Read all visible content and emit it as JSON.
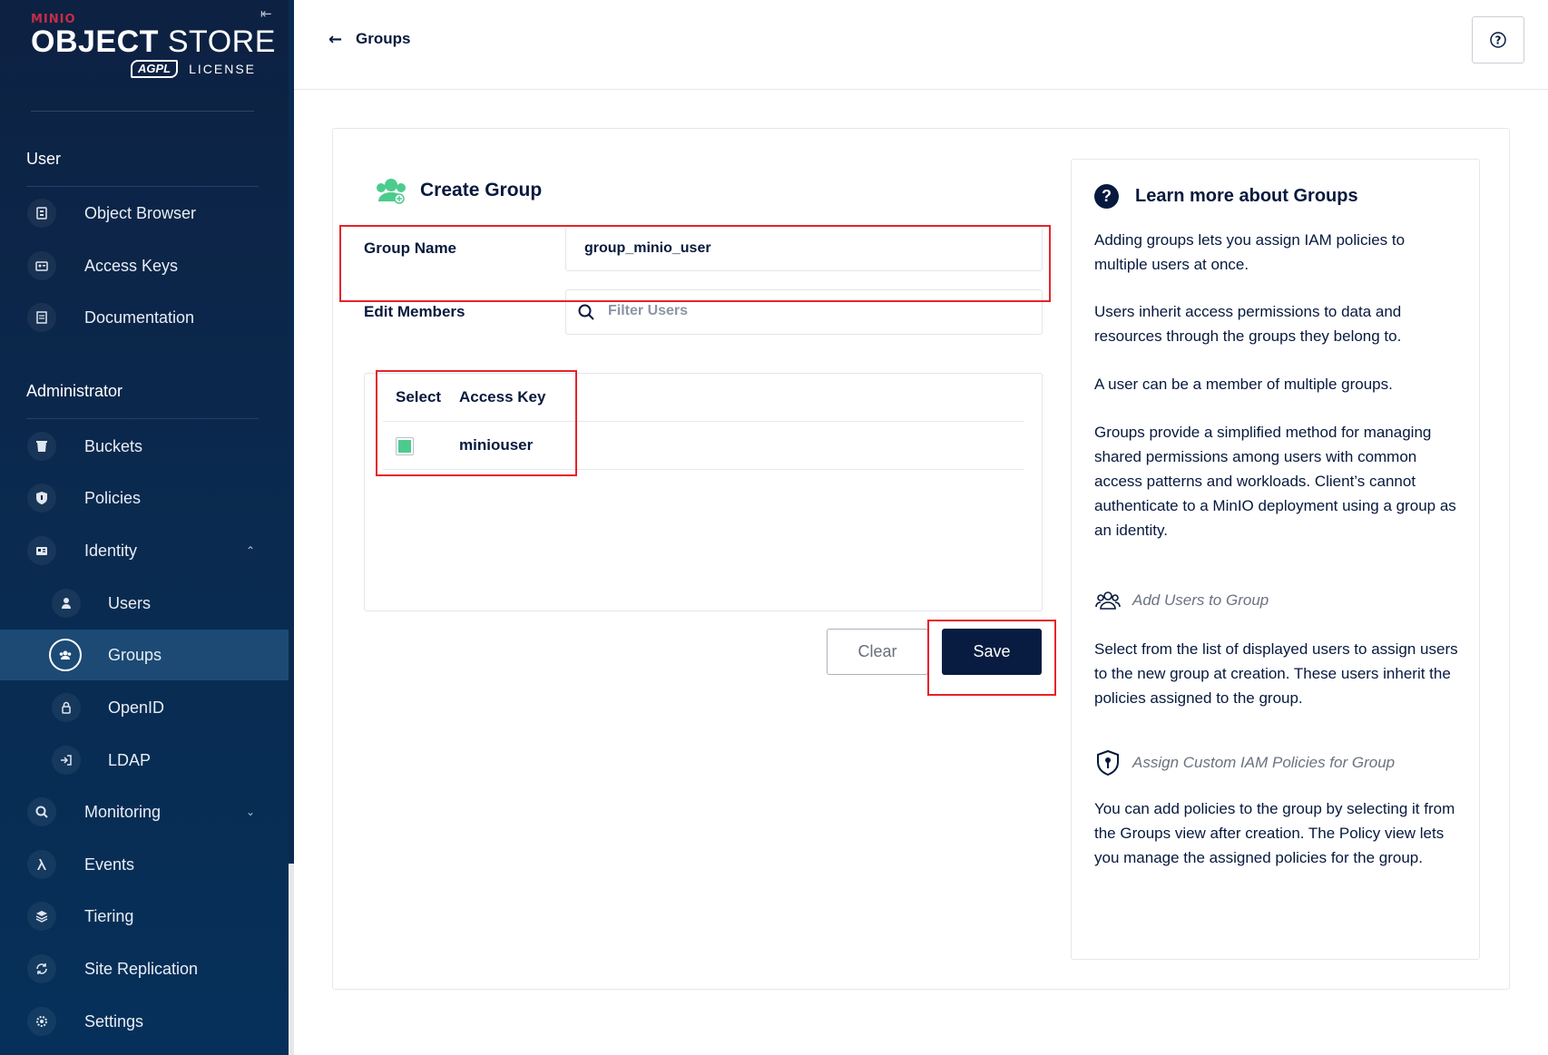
{
  "brand": {
    "small": "MINIO",
    "title_bold": "OBJECT",
    "title_light": " STORE",
    "agpl": "AGPL",
    "license": "LICENSE"
  },
  "sidebar": {
    "user_section": "User",
    "user_items": [
      {
        "label": "Object Browser",
        "icon": "object-browser-icon"
      },
      {
        "label": "Access Keys",
        "icon": "access-keys-icon"
      },
      {
        "label": "Documentation",
        "icon": "documentation-icon"
      }
    ],
    "admin_section": "Administrator",
    "admin_items": [
      {
        "label": "Buckets",
        "icon": "buckets-icon"
      },
      {
        "label": "Policies",
        "icon": "policies-icon"
      },
      {
        "label": "Identity",
        "icon": "identity-icon",
        "expanded": true
      },
      {
        "label": "Users",
        "icon": "users-icon",
        "sub": true
      },
      {
        "label": "Groups",
        "icon": "groups-icon",
        "sub": true,
        "active": true
      },
      {
        "label": "OpenID",
        "icon": "openid-icon",
        "sub": true
      },
      {
        "label": "LDAP",
        "icon": "ldap-icon",
        "sub": true
      },
      {
        "label": "Monitoring",
        "icon": "monitoring-icon",
        "expanded": false
      },
      {
        "label": "Events",
        "icon": "lambda-icon"
      },
      {
        "label": "Tiering",
        "icon": "tiering-icon"
      },
      {
        "label": "Site Replication",
        "icon": "site-replication-icon"
      },
      {
        "label": "Settings",
        "icon": "settings-icon"
      }
    ]
  },
  "header": {
    "back_label": "Groups"
  },
  "form": {
    "title": "Create Group",
    "group_name_label": "Group Name",
    "group_name_value": "group_minio_user",
    "edit_members_label": "Edit Members",
    "filter_placeholder": "Filter Users",
    "table_headers": [
      "Select",
      "Access Key"
    ],
    "rows": [
      {
        "access_key": "miniouser",
        "selected": true
      }
    ],
    "clear_label": "Clear",
    "save_label": "Save"
  },
  "help": {
    "title": "Learn more about Groups",
    "p1": "Adding groups lets you assign IAM policies to multiple users at once.",
    "p2": "Users inherit access permissions to data and resources through the groups they belong to.",
    "p3": "A user can be a member of multiple groups.",
    "p4": "Groups provide a simplified method for managing shared permissions among users with common access patterns and workloads. Client’s cannot authenticate to a MinIO deployment using a group as an identity.",
    "link1": "Add Users to Group",
    "p5": "Select from the list of displayed users to assign users to the new group at creation. These users inherit the policies assigned to the group.",
    "link2": "Assign Custom IAM Policies for Group",
    "p6": "You can add policies to the group by selecting it from the Groups view after creation. The Policy view lets you manage the assigned policies for the group."
  },
  "colors": {
    "sidebar": "#0d2142",
    "accent_green": "#4ccb8d",
    "save_bg": "#081c42",
    "highlight_red": "#e5232a"
  }
}
